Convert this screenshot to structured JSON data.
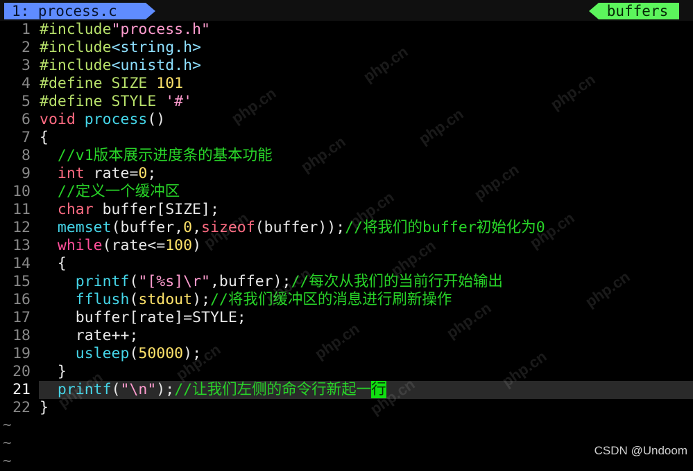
{
  "tabline": {
    "active_tab": "1: process.c",
    "buffers_label": "buffers"
  },
  "lines": [
    {
      "n": "1"
    },
    {
      "n": "2"
    },
    {
      "n": "3"
    },
    {
      "n": "4"
    },
    {
      "n": "5"
    },
    {
      "n": "6"
    },
    {
      "n": "7"
    },
    {
      "n": "8"
    },
    {
      "n": "9"
    },
    {
      "n": "10"
    },
    {
      "n": "11"
    },
    {
      "n": "12"
    },
    {
      "n": "13"
    },
    {
      "n": "14"
    },
    {
      "n": "15"
    },
    {
      "n": "16"
    },
    {
      "n": "17"
    },
    {
      "n": "18"
    },
    {
      "n": "19"
    },
    {
      "n": "20"
    },
    {
      "n": "21"
    },
    {
      "n": "22"
    }
  ],
  "code": {
    "l1": {
      "kw": "#include",
      "str": "\"process.h\""
    },
    "l2": {
      "kw": "#include",
      "inc": "<string.h>"
    },
    "l3": {
      "kw": "#include",
      "inc": "<unistd.h>"
    },
    "l4": {
      "kw": "#define",
      "name": " SIZE ",
      "val": "101"
    },
    "l5": {
      "kw": "#define",
      "name": " STYLE ",
      "val": "'#'"
    },
    "l6": {
      "type": "void",
      "fn": "process",
      "rest": "()"
    },
    "l7": {
      "text": "{"
    },
    "l8": {
      "comment": "//v1版本展示进度条的基本功能"
    },
    "l9": {
      "type": "int",
      "rest": " rate=",
      "num": "0",
      "end": ";"
    },
    "l10": {
      "comment": "//定义一个缓冲区"
    },
    "l11": {
      "type": "char",
      "rest": " buffer[SIZE];"
    },
    "l12": {
      "fn": "memset",
      "a": "(buffer,",
      "num": "0",
      "b": ",",
      "kw": "sizeof",
      "c": "(buffer));",
      "comment": "//将我们的buffer初始化为0"
    },
    "l13": {
      "kw": "while",
      "a": "(rate<=",
      "num": "100",
      "b": ")"
    },
    "l14": {
      "text": "{"
    },
    "l15": {
      "fn": "printf",
      "a": "(",
      "str": "\"[%s]\\r\"",
      "b": ",buffer);",
      "comment": "//每次从我们的当前行开始输出"
    },
    "l16": {
      "fn": "fflush",
      "a": "(",
      "macro": "stdout",
      "b": ");",
      "comment": "//将我们缓冲区的消息进行刷新操作"
    },
    "l17": {
      "text": "buffer[rate]=STYLE;"
    },
    "l18": {
      "text": "rate++;"
    },
    "l19": {
      "fn": "usleep",
      "a": "(",
      "num": "50000",
      "b": ");"
    },
    "l20": {
      "text": "}"
    },
    "l21": {
      "fn": "printf",
      "a": "(",
      "str": "\"\\n\"",
      "b": ");",
      "comment": "//让我们左侧的命令行新起一",
      "cursor": "行"
    },
    "l22": {
      "text": "}"
    }
  },
  "empty_line_marker": "~",
  "credit": "CSDN @Undoom",
  "watermark_text": "php.cn",
  "colors": {
    "tab_active": "#5f8cff",
    "tab_buffers": "#5cf55c",
    "comment": "#28d428",
    "keyword": "#ff4f9a",
    "function": "#45d5e8",
    "number": "#ffe36a"
  }
}
